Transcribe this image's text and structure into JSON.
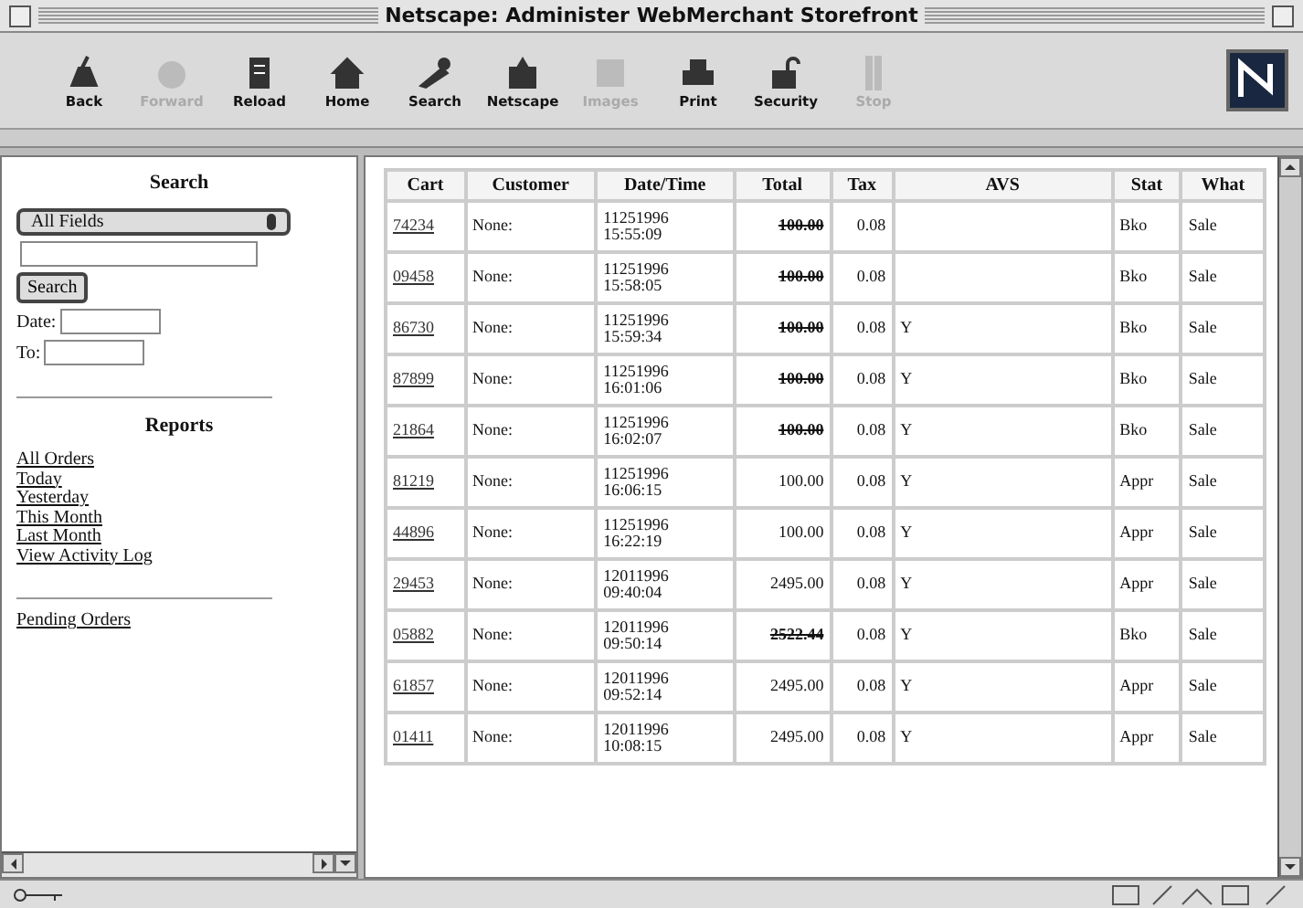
{
  "window": {
    "title": "Netscape: Administer WebMerchant Storefront"
  },
  "toolbar": [
    {
      "label": "Back",
      "disabled": false
    },
    {
      "label": "Forward",
      "disabled": true
    },
    {
      "label": "Reload",
      "disabled": false
    },
    {
      "label": "Home",
      "disabled": false
    },
    {
      "label": "Search",
      "disabled": false
    },
    {
      "label": "Netscape",
      "disabled": false
    },
    {
      "label": "Images",
      "disabled": true
    },
    {
      "label": "Print",
      "disabled": false
    },
    {
      "label": "Security",
      "disabled": false
    },
    {
      "label": "Stop",
      "disabled": true
    }
  ],
  "sidebar": {
    "search_heading": "Search",
    "field_select": "All Fields",
    "search_button": "Search",
    "date_label": "Date:",
    "to_label": "To:",
    "reports_heading": "Reports",
    "report_links": [
      "All Orders",
      "Today",
      "Yesterday",
      "This Month",
      "Last Month",
      "View Activity Log"
    ],
    "extra_links": [
      "Pending Orders"
    ]
  },
  "table": {
    "columns": [
      "Cart",
      "Customer",
      "Date/Time",
      "Total",
      "Tax",
      "AVS",
      "Stat",
      "What"
    ],
    "rows": [
      {
        "cart": "74234",
        "customer": "None:",
        "date": "11251996",
        "time": "15:55:09",
        "total": "100.00",
        "voided": true,
        "tax": "0.08",
        "avs": "",
        "stat": "Bko",
        "what": "Sale"
      },
      {
        "cart": "09458",
        "customer": "None:",
        "date": "11251996",
        "time": "15:58:05",
        "total": "100.00",
        "voided": true,
        "tax": "0.08",
        "avs": "",
        "stat": "Bko",
        "what": "Sale"
      },
      {
        "cart": "86730",
        "customer": "None:",
        "date": "11251996",
        "time": "15:59:34",
        "total": "100.00",
        "voided": true,
        "tax": "0.08",
        "avs": "Y",
        "stat": "Bko",
        "what": "Sale"
      },
      {
        "cart": "87899",
        "customer": "None:",
        "date": "11251996",
        "time": "16:01:06",
        "total": "100.00",
        "voided": true,
        "tax": "0.08",
        "avs": "Y",
        "stat": "Bko",
        "what": "Sale"
      },
      {
        "cart": "21864",
        "customer": "None:",
        "date": "11251996",
        "time": "16:02:07",
        "total": "100.00",
        "voided": true,
        "tax": "0.08",
        "avs": "Y",
        "stat": "Bko",
        "what": "Sale"
      },
      {
        "cart": "81219",
        "customer": "None:",
        "date": "11251996",
        "time": "16:06:15",
        "total": "100.00",
        "voided": false,
        "tax": "0.08",
        "avs": "Y",
        "stat": "Appr",
        "what": "Sale"
      },
      {
        "cart": "44896",
        "customer": "None:",
        "date": "11251996",
        "time": "16:22:19",
        "total": "100.00",
        "voided": false,
        "tax": "0.08",
        "avs": "Y",
        "stat": "Appr",
        "what": "Sale"
      },
      {
        "cart": "29453",
        "customer": "None:",
        "date": "12011996",
        "time": "09:40:04",
        "total": "2495.00",
        "voided": false,
        "tax": "0.08",
        "avs": "Y",
        "stat": "Appr",
        "what": "Sale"
      },
      {
        "cart": "05882",
        "customer": "None:",
        "date": "12011996",
        "time": "09:50:14",
        "total": "2522.44",
        "voided": true,
        "tax": "0.08",
        "avs": "Y",
        "stat": "Bko",
        "what": "Sale"
      },
      {
        "cart": "61857",
        "customer": "None:",
        "date": "12011996",
        "time": "09:52:14",
        "total": "2495.00",
        "voided": false,
        "tax": "0.08",
        "avs": "Y",
        "stat": "Appr",
        "what": "Sale"
      },
      {
        "cart": "01411",
        "customer": "None:",
        "date": "12011996",
        "time": "10:08:15",
        "total": "2495.00",
        "voided": false,
        "tax": "0.08",
        "avs": "Y",
        "stat": "Appr",
        "what": "Sale"
      }
    ]
  }
}
